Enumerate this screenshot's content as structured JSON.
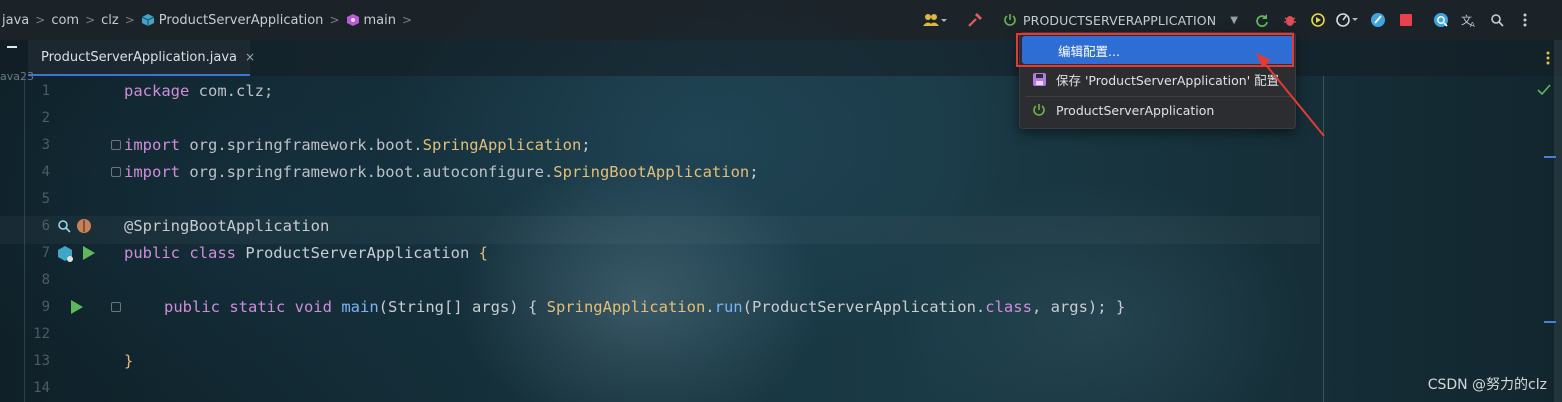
{
  "breadcrumb": {
    "items": [
      "java",
      "com",
      "clz",
      "ProductServerApplication",
      "main"
    ],
    "separator": ">"
  },
  "run_config": {
    "label": "PRODUCTSERVERAPPLICATION"
  },
  "tab": {
    "label": "ProductServerApplication.java",
    "close": "×"
  },
  "side_hint": "ava23",
  "editor": {
    "line_numbers": [
      "1",
      "2",
      "3",
      "4",
      "5",
      "6",
      "7",
      "8",
      "9",
      "12",
      "13",
      "14"
    ],
    "lines": {
      "l1": [
        "package",
        " com.clz;"
      ],
      "l3": [
        "import",
        " org.springframework.boot.",
        "SpringApplication",
        ";"
      ],
      "l4": [
        "import",
        " org.springframework.boot.autoconfigure.",
        "SpringBootApplication",
        ";"
      ],
      "l6": [
        "@SpringBootApplication"
      ],
      "l7": [
        "public class",
        " ProductServerApplication ",
        "{"
      ],
      "l9": [
        "public static void",
        " ",
        "main",
        "(String[] args) { ",
        "SpringApplication",
        ".",
        "run",
        "(ProductServerApplication.",
        "class",
        ", args); }"
      ],
      "l13": [
        "}"
      ]
    }
  },
  "popup": {
    "items": [
      {
        "label": "编辑配置..."
      },
      {
        "label": "保存 'ProductServerApplication' 配置"
      },
      {
        "label": "ProductServerApplication"
      }
    ]
  },
  "watermark": "CSDN @努力的clz",
  "colors": {
    "accent": "#2e6ed4",
    "highlight_box": "#e53935",
    "keyword": "#cf8dd9",
    "class": "#e1bf7a",
    "function": "#7ab4f5"
  }
}
